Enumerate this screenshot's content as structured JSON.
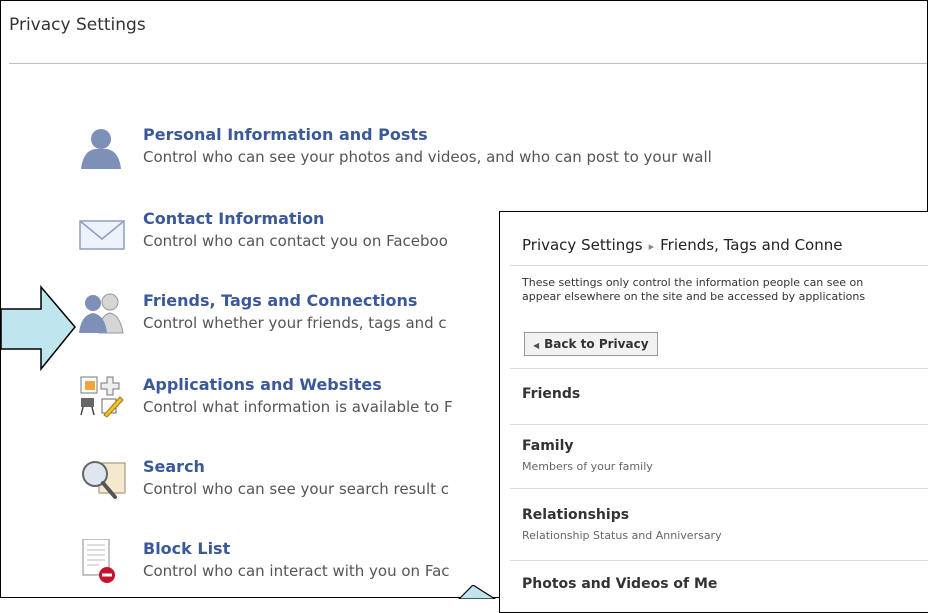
{
  "page": {
    "title": "Privacy Settings"
  },
  "items": [
    {
      "label": "Personal Information and Posts",
      "desc": "Control who can see your photos and videos, and who can post to your wall"
    },
    {
      "label": "Contact Information",
      "desc": "Control who can contact you on Faceboo"
    },
    {
      "label": "Friends, Tags and Connections",
      "desc": "Control whether your friends, tags and c"
    },
    {
      "label": "Applications and Websites",
      "desc": "Control what information is available to F"
    },
    {
      "label": "Search",
      "desc": "Control who can see your search result c"
    },
    {
      "label": "Block List",
      "desc": "Control who can interact with you on Fac"
    }
  ],
  "panel": {
    "breadcrumb_root": "Privacy Settings",
    "breadcrumb_sep": "▸",
    "breadcrumb_current": "Friends, Tags and Conne",
    "notice_line1": "These settings only control the information people can see on",
    "notice_line2": "appear elsewhere on the site and be accessed by applications",
    "back_label": "Back to Privacy",
    "rows": [
      {
        "title": "Friends",
        "subtitle": ""
      },
      {
        "title": "Family",
        "subtitle": "Members of your family"
      },
      {
        "title": "Relationships",
        "subtitle": "Relationship Status and Anniversary"
      },
      {
        "title": "Photos and Videos of Me",
        "subtitle": ""
      }
    ]
  },
  "colors": {
    "link": "#3b5998",
    "icon": "#7e8fb8",
    "arrow_fill": "#bfe6ee"
  },
  "icons": [
    "person-icon",
    "envelope-icon",
    "friends-icon",
    "applications-icon",
    "search-magnifier-icon",
    "block-list-icon"
  ]
}
